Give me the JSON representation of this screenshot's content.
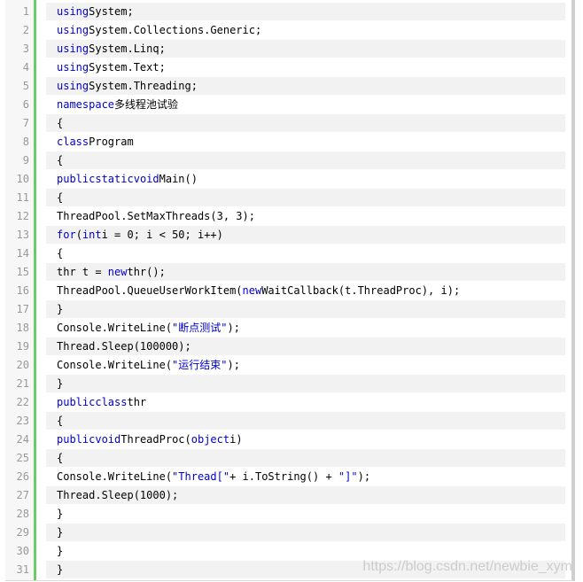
{
  "editor": {
    "lines": [
      {
        "n": "1",
        "parts": [
          {
            "t": "using",
            "c": "kw"
          },
          {
            "t": "System;",
            "c": ""
          }
        ]
      },
      {
        "n": "2",
        "parts": [
          {
            "t": "using",
            "c": "kw"
          },
          {
            "t": "System.Collections.Generic;",
            "c": ""
          }
        ]
      },
      {
        "n": "3",
        "parts": [
          {
            "t": "using",
            "c": "kw"
          },
          {
            "t": "System.Linq;",
            "c": ""
          }
        ]
      },
      {
        "n": "4",
        "parts": [
          {
            "t": "using",
            "c": "kw"
          },
          {
            "t": "System.Text;",
            "c": ""
          }
        ]
      },
      {
        "n": "5",
        "parts": [
          {
            "t": "using",
            "c": "kw"
          },
          {
            "t": "System.Threading;",
            "c": ""
          }
        ]
      },
      {
        "n": "6",
        "parts": [
          {
            "t": "namespace",
            "c": "kw"
          },
          {
            "t": "多线程池试验",
            "c": ""
          }
        ]
      },
      {
        "n": "7",
        "parts": [
          {
            "t": "{",
            "c": ""
          }
        ]
      },
      {
        "n": "8",
        "parts": [
          {
            "t": "class",
            "c": "kw"
          },
          {
            "t": "Program",
            "c": ""
          }
        ]
      },
      {
        "n": "9",
        "parts": [
          {
            "t": "{",
            "c": ""
          }
        ]
      },
      {
        "n": "10",
        "parts": [
          {
            "t": "public",
            "c": "kw"
          },
          {
            "t": "static",
            "c": "kw"
          },
          {
            "t": "void",
            "c": "kw"
          },
          {
            "t": "Main()",
            "c": ""
          }
        ]
      },
      {
        "n": "11",
        "parts": [
          {
            "t": "{",
            "c": ""
          }
        ]
      },
      {
        "n": "12",
        "parts": [
          {
            "t": "ThreadPool.SetMaxThreads(3, 3);",
            "c": ""
          }
        ]
      },
      {
        "n": "13",
        "parts": [
          {
            "t": "for",
            "c": "kw"
          },
          {
            "t": "(",
            "c": ""
          },
          {
            "t": "int",
            "c": "kw"
          },
          {
            "t": "i = 0; i < 50; i++)",
            "c": ""
          }
        ]
      },
      {
        "n": "14",
        "parts": [
          {
            "t": "{",
            "c": ""
          }
        ]
      },
      {
        "n": "15",
        "parts": [
          {
            "t": "thr t = ",
            "c": ""
          },
          {
            "t": "new",
            "c": "kw"
          },
          {
            "t": "thr();",
            "c": ""
          }
        ]
      },
      {
        "n": "16",
        "parts": [
          {
            "t": "ThreadPool.QueueUserWorkItem(",
            "c": ""
          },
          {
            "t": "new",
            "c": "kw"
          },
          {
            "t": "WaitCallback(t.ThreadProc), i);",
            "c": ""
          }
        ]
      },
      {
        "n": "17",
        "parts": [
          {
            "t": "}",
            "c": ""
          }
        ]
      },
      {
        "n": "18",
        "parts": [
          {
            "t": "Console.WriteLine(",
            "c": ""
          },
          {
            "t": "\"断点测试\"",
            "c": "strb"
          },
          {
            "t": ");",
            "c": ""
          }
        ]
      },
      {
        "n": "19",
        "parts": [
          {
            "t": "Thread.Sleep(100000);",
            "c": ""
          }
        ]
      },
      {
        "n": "20",
        "parts": [
          {
            "t": "Console.WriteLine(",
            "c": ""
          },
          {
            "t": "\"运行结束\"",
            "c": "strb"
          },
          {
            "t": ");",
            "c": ""
          }
        ]
      },
      {
        "n": "21",
        "parts": [
          {
            "t": "}",
            "c": ""
          }
        ]
      },
      {
        "n": "22",
        "parts": [
          {
            "t": "public",
            "c": "kw"
          },
          {
            "t": "class",
            "c": "kw"
          },
          {
            "t": "thr",
            "c": ""
          }
        ]
      },
      {
        "n": "23",
        "parts": [
          {
            "t": "{",
            "c": ""
          }
        ]
      },
      {
        "n": "24",
        "parts": [
          {
            "t": "public",
            "c": "kw"
          },
          {
            "t": "void",
            "c": "kw"
          },
          {
            "t": "ThreadProc(",
            "c": ""
          },
          {
            "t": "object",
            "c": "kw"
          },
          {
            "t": "i)",
            "c": ""
          }
        ]
      },
      {
        "n": "25",
        "parts": [
          {
            "t": "{",
            "c": ""
          }
        ]
      },
      {
        "n": "26",
        "parts": [
          {
            "t": "Console.WriteLine(",
            "c": ""
          },
          {
            "t": "\"Thread[\"",
            "c": "strb"
          },
          {
            "t": "+ i.ToString() + ",
            "c": ""
          },
          {
            "t": "\"]\"",
            "c": "strb"
          },
          {
            "t": ");",
            "c": ""
          }
        ]
      },
      {
        "n": "27",
        "parts": [
          {
            "t": "Thread.Sleep(1000);",
            "c": ""
          }
        ]
      },
      {
        "n": "28",
        "parts": [
          {
            "t": "}",
            "c": ""
          }
        ]
      },
      {
        "n": "29",
        "parts": [
          {
            "t": "}",
            "c": ""
          }
        ]
      },
      {
        "n": "30",
        "parts": [
          {
            "t": "}",
            "c": ""
          }
        ]
      },
      {
        "n": "31",
        "parts": [
          {
            "t": "}",
            "c": ""
          }
        ]
      }
    ]
  },
  "watermark": "https://blog.csdn.net/newbie_xym",
  "colors": {
    "keyword": "#0000cc",
    "gutter_accent": "#6ccc6c",
    "stripe": "#f2f2f2"
  }
}
